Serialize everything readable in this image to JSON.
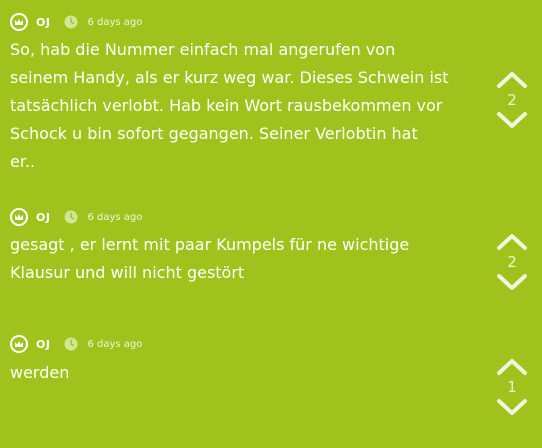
{
  "posts": [
    {
      "author": "OJ",
      "time": "6 days ago",
      "text_lines": [
        "So, hab die Nummer einfach mal angerufen von",
        "seinem Handy, als er kurz weg war. Dieses Schwein ist",
        "tatsächlich verlobt. Hab kein Wort rausbekommen vor",
        "Schock u bin sofort gegangen. Seiner Verlobtin hat",
        "er.."
      ],
      "votes": "2"
    },
    {
      "author": "OJ",
      "time": "6 days ago",
      "text_lines": [
        "gesagt , er lernt mit paar Kumpels für ne wichtige",
        "Klausur und will nicht gestört"
      ],
      "votes": "2"
    },
    {
      "author": "OJ",
      "time": "6 days ago",
      "text_lines": [
        "werden"
      ],
      "votes": "1"
    }
  ],
  "icons": {
    "badge": "crown-icon",
    "time": "clock-icon",
    "up": "chevron-up-icon",
    "down": "chevron-down-icon"
  },
  "colors": {
    "background": "#9fc31c",
    "text": "#ffffff"
  }
}
